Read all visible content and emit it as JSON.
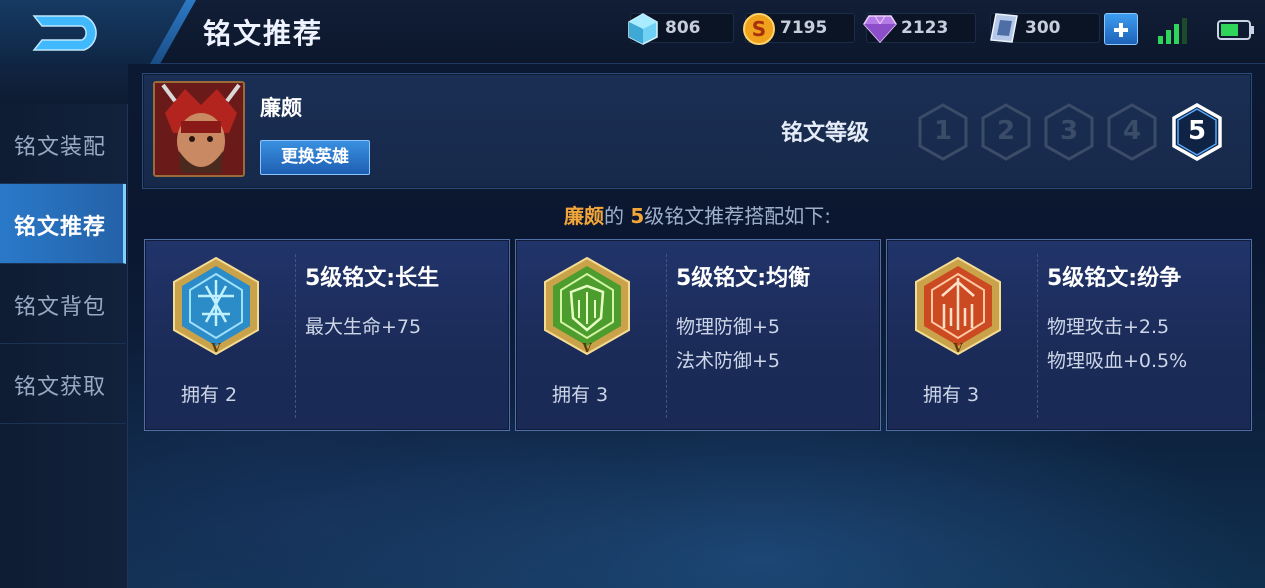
{
  "header": {
    "title": "铭文推荐",
    "currencies": [
      {
        "icon": "crystal-icon",
        "value": "806"
      },
      {
        "icon": "gold-coin-icon",
        "value": "7195"
      },
      {
        "icon": "diamond-icon",
        "value": "2123"
      },
      {
        "icon": "voucher-icon",
        "value": "300"
      }
    ]
  },
  "sidebar": {
    "items": [
      {
        "label": "铭文装配",
        "active": false
      },
      {
        "label": "铭文推荐",
        "active": true
      },
      {
        "label": "铭文背包",
        "active": false
      },
      {
        "label": "铭文获取",
        "active": false
      }
    ]
  },
  "hero": {
    "name": "廉颇",
    "change_label": "更换英雄"
  },
  "level": {
    "label": "铭文等级",
    "options": [
      "1",
      "2",
      "3",
      "4",
      "5"
    ],
    "selected": "5"
  },
  "recommend": {
    "hero": "廉颇",
    "mid": "的 ",
    "level": "5",
    "tail": "级铭文推荐搭配如下:"
  },
  "cards": [
    {
      "title": "5级铭文:长生",
      "stats": [
        "最大生命+75"
      ],
      "owned": "拥有 2",
      "color": "#3aa0d8"
    },
    {
      "title": "5级铭文:均衡",
      "stats": [
        "物理防御+5",
        "法术防御+5"
      ],
      "owned": "拥有 3",
      "color": "#4faa3a"
    },
    {
      "title": "5级铭文:纷争",
      "stats": [
        "物理攻击+2.5",
        "物理吸血+0.5%"
      ],
      "owned": "拥有 3",
      "color": "#d2532a"
    }
  ]
}
